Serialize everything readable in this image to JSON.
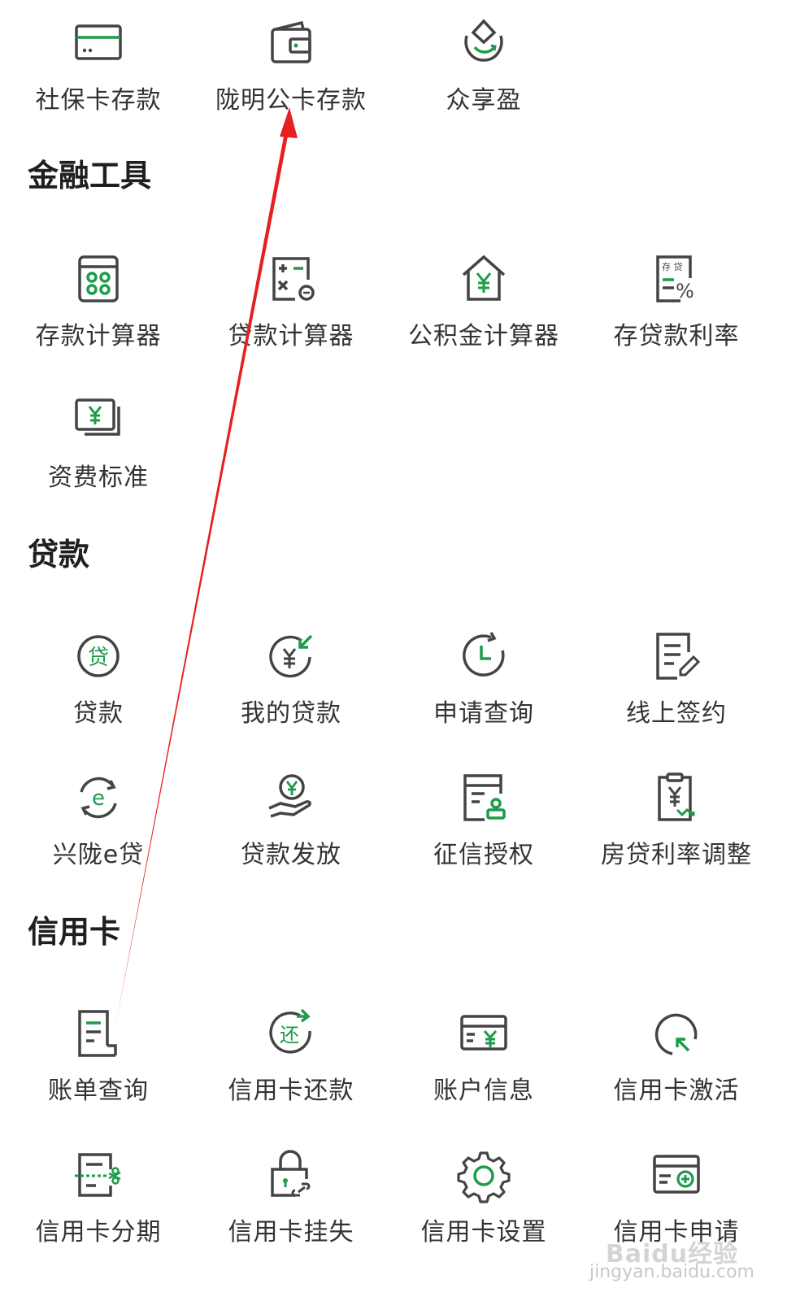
{
  "sections": {
    "top_row": {
      "items": [
        {
          "label": "社保卡存款",
          "icon": "card-icon"
        },
        {
          "label": "陇明公卡存款",
          "icon": "wallet-icon"
        },
        {
          "label": "众享盈",
          "icon": "lotus-icon"
        }
      ]
    },
    "finance_tools": {
      "title": "金融工具",
      "items": [
        {
          "label": "存款计算器",
          "icon": "calculator-icon"
        },
        {
          "label": "贷款计算器",
          "icon": "loan-calculator-icon"
        },
        {
          "label": "公积金计算器",
          "icon": "house-yuan-icon"
        },
        {
          "label": "存贷款利率",
          "icon": "rate-document-icon"
        },
        {
          "label": "资费标准",
          "icon": "fee-icon"
        }
      ]
    },
    "loans": {
      "title": "贷款",
      "items": [
        {
          "label": "贷款",
          "icon": "loan-badge-icon",
          "glyph": "贷"
        },
        {
          "label": "我的贷款",
          "icon": "my-loan-icon"
        },
        {
          "label": "申请查询",
          "icon": "clock-icon"
        },
        {
          "label": "线上签约",
          "icon": "sign-document-icon"
        },
        {
          "label": "兴陇e贷",
          "icon": "e-loan-icon",
          "glyph": "e"
        },
        {
          "label": "贷款发放",
          "icon": "hand-coin-icon"
        },
        {
          "label": "征信授权",
          "icon": "credit-auth-icon"
        },
        {
          "label": "房贷利率调整",
          "icon": "rate-adjust-icon"
        }
      ]
    },
    "credit_card": {
      "title": "信用卡",
      "items": [
        {
          "label": "账单查询",
          "icon": "bill-icon"
        },
        {
          "label": "信用卡还款",
          "icon": "repay-icon",
          "glyph": "还"
        },
        {
          "label": "账户信息",
          "icon": "account-card-icon"
        },
        {
          "label": "信用卡激活",
          "icon": "activate-icon"
        },
        {
          "label": "信用卡分期",
          "icon": "installment-icon"
        },
        {
          "label": "信用卡挂失",
          "icon": "lock-icon"
        },
        {
          "label": "信用卡设置",
          "icon": "gear-icon"
        },
        {
          "label": "信用卡申请",
          "icon": "card-apply-icon"
        }
      ]
    }
  },
  "colors": {
    "icon_gray": "#444444",
    "icon_green": "#1e9b4b",
    "annotation_red": "#e62020"
  },
  "watermark": {
    "brand": "Baidu经验",
    "url": "jingyan.baidu.com"
  }
}
